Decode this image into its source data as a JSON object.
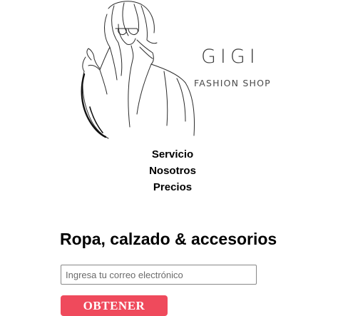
{
  "brand": {
    "name": "GIGI",
    "tagline": "FASHION SHOP"
  },
  "nav": {
    "items": [
      "Servicio",
      "Nosotros",
      "Precios"
    ]
  },
  "hero": {
    "illustration": "woman-line-art-illustration"
  },
  "headline": "Ropa, calzado & accesorios",
  "signup": {
    "email_placeholder": "Ingresa tu correo electrónico",
    "email_value": "",
    "button_label": "OBTENER"
  },
  "colors": {
    "accent": "#ef4a5c",
    "text": "#000000",
    "brand_text": "#3c3c3c"
  }
}
